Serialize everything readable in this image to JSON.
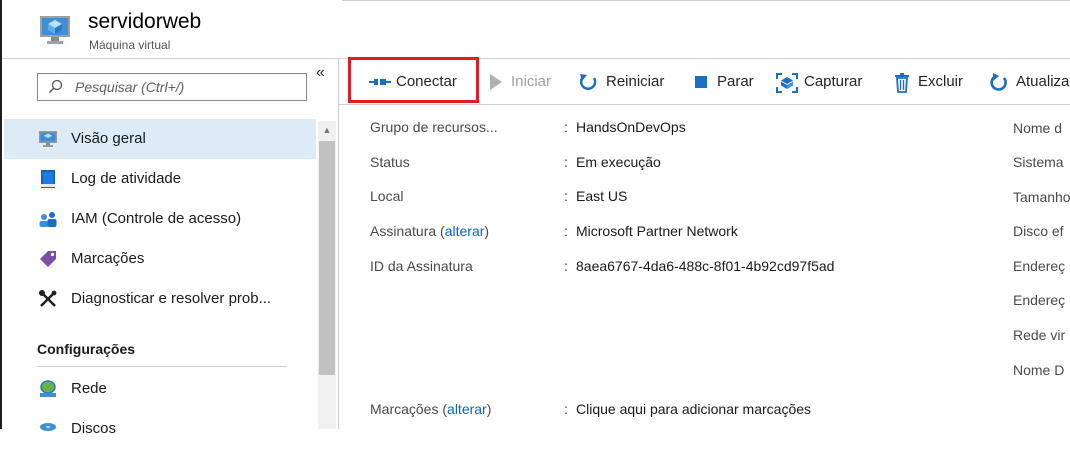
{
  "header": {
    "title": "servidorweb",
    "subtitle": "Máquina virtual"
  },
  "sidebar": {
    "search_placeholder": "Pesquisar (Ctrl+/)",
    "collapse_glyph": "«",
    "items": [
      {
        "label": "Visão geral",
        "icon": "monitor-icon",
        "active": true
      },
      {
        "label": "Log de atividade",
        "icon": "log-book-icon"
      },
      {
        "label": "IAM (Controle de acesso)",
        "icon": "users-icon"
      },
      {
        "label": "Marcações",
        "icon": "tag-icon"
      },
      {
        "label": "Diagnosticar e resolver prob...",
        "icon": "wrench-icon"
      }
    ],
    "section_title": "Configurações",
    "section_items": [
      {
        "label": "Rede",
        "icon": "network-icon"
      },
      {
        "label": "Discos",
        "icon": "disk-icon"
      }
    ]
  },
  "toolbar": {
    "buttons": [
      {
        "label": "Conectar",
        "icon": "connect-icon",
        "enabled": true,
        "highlighted": true
      },
      {
        "label": "Iniciar",
        "icon": "play-icon",
        "enabled": false
      },
      {
        "label": "Reiniciar",
        "icon": "restart-icon",
        "enabled": true
      },
      {
        "label": "Parar",
        "icon": "stop-icon",
        "enabled": true
      },
      {
        "label": "Capturar",
        "icon": "capture-icon",
        "enabled": true
      },
      {
        "label": "Excluir",
        "icon": "trash-icon",
        "enabled": true
      },
      {
        "label": "Atualizar",
        "icon": "refresh-icon",
        "enabled": true
      }
    ]
  },
  "essentials": {
    "rows": [
      {
        "key": "Grupo de recursos...",
        "value": "HandsOnDevOps",
        "is_link": true
      },
      {
        "key": "Status",
        "value": "Em execução"
      },
      {
        "key": "Local",
        "value": "East US"
      },
      {
        "key_prefix": "Assinatura (",
        "key_link": "alterar",
        "key_suffix": ")",
        "value": "Microsoft Partner Network",
        "is_link": true
      },
      {
        "key": "ID da Assinatura",
        "value": "8aea6767-4da6-488c-8f01-4b92cd97f5ad"
      }
    ],
    "tags_row": {
      "key_prefix": "Marcações (",
      "key_link": "alterar",
      "key_suffix": ")",
      "value": "Clique aqui para adicionar marcações"
    },
    "right_keys": [
      "Nome d",
      "Sistema",
      "Tamanho",
      "Disco ef",
      "Endereç",
      "Endereç",
      "Rede vir",
      "Nome D"
    ]
  },
  "colors": {
    "accent_link": "#0a63c7",
    "active_nav_bg": "#ddebf6",
    "highlight_border": "#e01c24",
    "icon_blue": "#0a63c7"
  }
}
